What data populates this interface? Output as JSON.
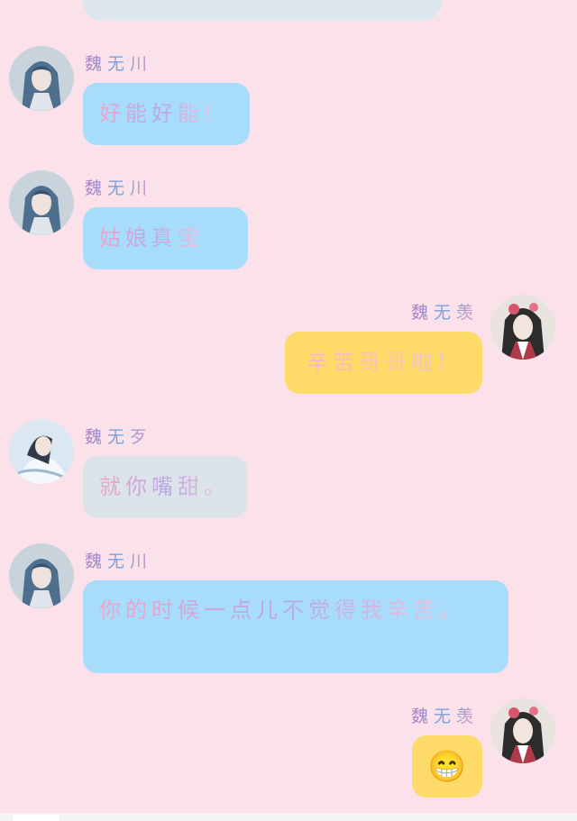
{
  "messages": [
    {
      "sender": "魏无川",
      "text": "好能好能!",
      "side": "left",
      "avatar_icon": "blue-haired-character-avatar-icon"
    },
    {
      "sender": "魏无川",
      "text": "姑娘真宝",
      "side": "left",
      "avatar_icon": "blue-haired-character-avatar-icon"
    },
    {
      "sender": "魏无羡",
      "text": "辛苦哥哥啦!",
      "side": "right",
      "avatar_icon": "red-robed-character-avatar-icon"
    },
    {
      "sender": "魏无歹",
      "text": "就你嘴甜。",
      "side": "left",
      "avatar_icon": "white-robed-character-avatar-icon"
    },
    {
      "sender": "魏无川",
      "text": "你的时候一点儿不觉得我辛苦。",
      "side": "left",
      "avatar_icon": "blue-haired-character-avatar-icon"
    },
    {
      "sender": "魏无羡",
      "text": "😁",
      "side": "right",
      "avatar_icon": "red-robed-character-avatar-icon"
    }
  ],
  "colors": {
    "background": "#fbe1ea",
    "left_bubble": "#a8dcfb",
    "right_bubble": "#fedb68",
    "grey_bubble": "#dce4ea"
  }
}
